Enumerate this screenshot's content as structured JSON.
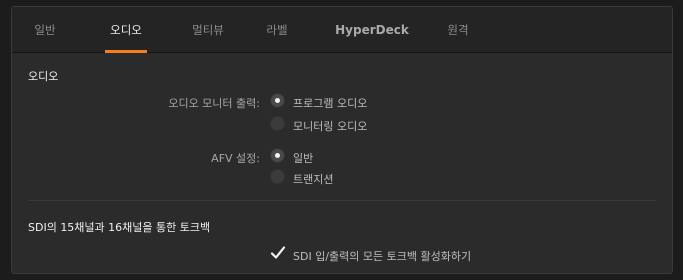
{
  "tabs": [
    {
      "label": "일반",
      "active": false
    },
    {
      "label": "오디오",
      "active": true
    },
    {
      "label": "멀티뷰",
      "active": false
    },
    {
      "label": "라벨",
      "active": false
    },
    {
      "label": "HyperDeck",
      "active": false
    },
    {
      "label": "원격",
      "active": false
    }
  ],
  "audio": {
    "section_title": "오디오",
    "monitor_output": {
      "label": "오디오 모니터 출력:",
      "options": [
        "프로그램 오디오",
        "모니터링 오디오"
      ],
      "selected": "프로그램 오디오"
    },
    "afv": {
      "label": "AFV 설정:",
      "options": [
        "일반",
        "트랜지션"
      ],
      "selected": "일반"
    }
  },
  "talkback": {
    "section_title": "SDI의 15채널과 16채널을 통한 토크백",
    "checkbox_label": "SDI 입/출력의 모든 토크백 활성화하기",
    "checked": true
  },
  "colors": {
    "accent": "#f57c1f",
    "background": "#2b2b2b",
    "tabbar": "#242424"
  }
}
